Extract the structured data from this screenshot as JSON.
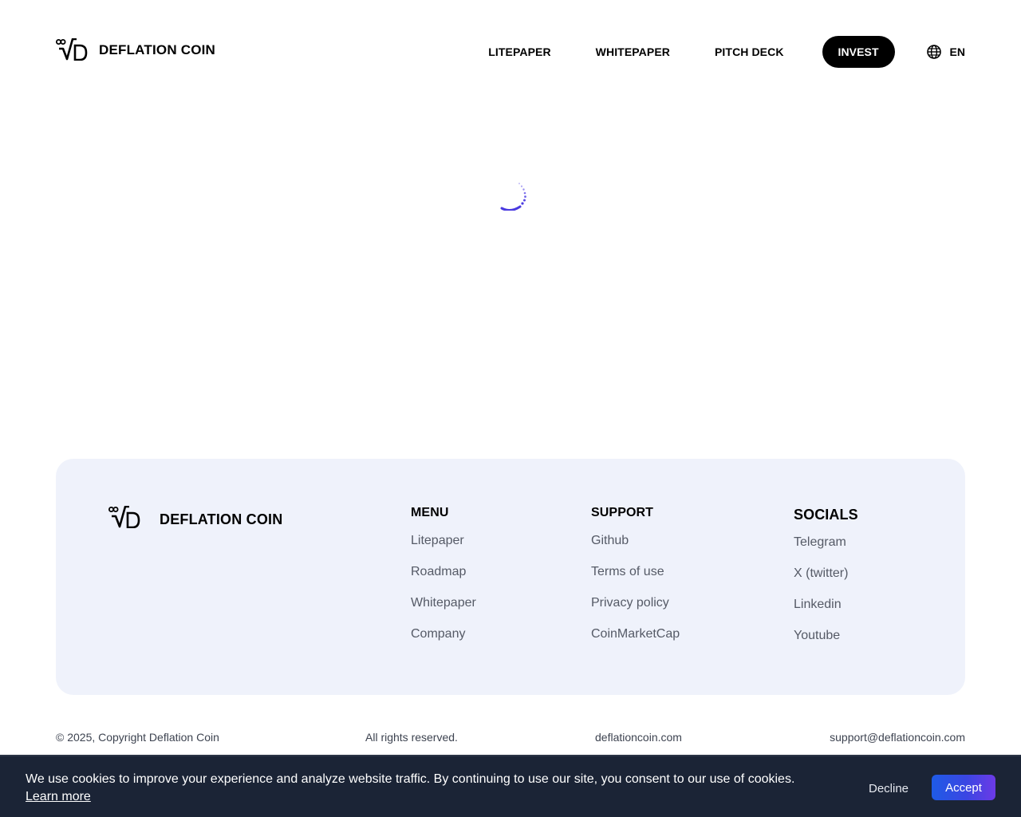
{
  "header": {
    "brand": "DEFLATION COIN",
    "nav": [
      "LITEPAPER",
      "WHITEPAPER",
      "PITCH DECK"
    ],
    "invest_label": "INVEST",
    "language": "EN"
  },
  "footer": {
    "brand": "DEFLATION COIN",
    "menu": {
      "title": "MENU",
      "items": [
        "Litepaper",
        "Roadmap",
        "Whitepaper",
        "Company"
      ]
    },
    "support": {
      "title": "SUPPORT",
      "items": [
        "Github",
        "Terms of use",
        "Privacy policy",
        "CoinMarketCap"
      ]
    },
    "socials": {
      "title": "SOCIALS",
      "items": [
        "Telegram",
        "X (twitter)",
        "Linkedin",
        "Youtube"
      ]
    }
  },
  "bottom": {
    "copyright": "© 2025, Copyright Deflation Coin",
    "rights": "All rights reserved.",
    "domain": "deflationcoin.com",
    "email": "support@deflationcoin.com"
  },
  "cookie": {
    "message": "We use cookies to improve your experience and analyze website traffic. By continuing to use our site, you consent to our use of cookies.",
    "learn_more": "Learn more",
    "decline": "Decline",
    "accept": "Accept"
  },
  "colors": {
    "accent": "#4a3ae0",
    "footer_bg": "#eff2fb",
    "banner_bg": "#1b2436",
    "accept_gradient_start": "#1e5be6",
    "accept_gradient_end": "#6c3ae6"
  },
  "icons": [
    "logo-mark-icon",
    "globe-icon",
    "loading-spinner-icon"
  ]
}
